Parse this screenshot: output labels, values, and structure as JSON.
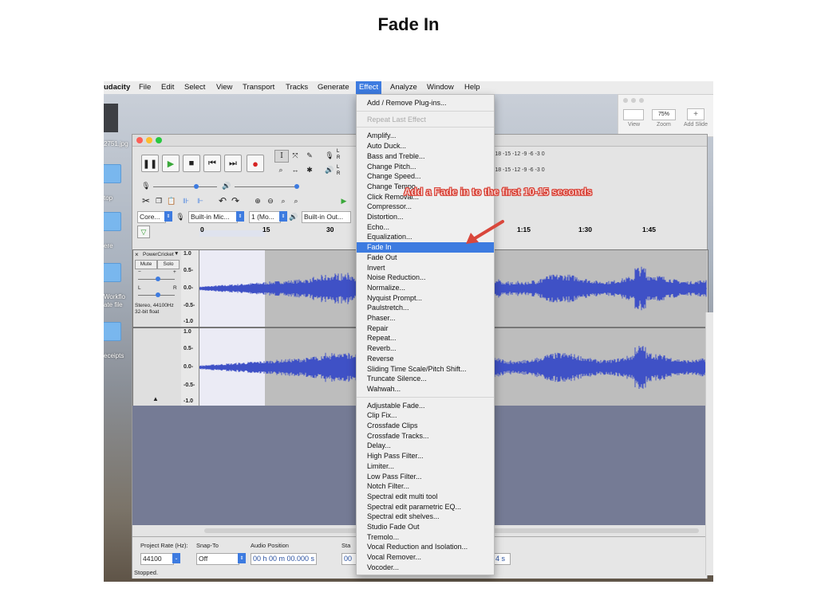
{
  "slide": {
    "title": "Fade In"
  },
  "menubar": {
    "app_name": "udacity",
    "items": [
      "File",
      "Edit",
      "Select",
      "View",
      "Transport",
      "Tracks",
      "Generate",
      "Effect",
      "Analyze",
      "Window",
      "Help"
    ]
  },
  "desktop": {
    "icons": [
      "2751.jpg",
      "top",
      "ere",
      "Workflo",
      "ate file",
      "eceipts"
    ]
  },
  "keynote": {
    "zoom": "75%",
    "view_label": "View",
    "zoom_label": "Zoom",
    "add_slide_label": "Add Slide",
    "plus": "+"
  },
  "toolbar": {
    "pause": "❚❚",
    "play": "▶",
    "stop": "■",
    "skip_start": "⏮",
    "skip_end": "⏭",
    "record": "●",
    "meter_scale": "-18 -15 -12 -9 -6 -3 0",
    "meter_scale_short": "-18 -15 -12 -9 -6 -3 0",
    "lr_top": "L",
    "lr_bottom": "R",
    "host_combo": "Core...",
    "input_device": "Built-in Mic...",
    "channels": "1 (Mo...",
    "output_device": "Built-in Out..."
  },
  "ruler": {
    "ticks": [
      "0",
      "15",
      "30",
      "1:15",
      "1:30",
      "1:45"
    ]
  },
  "tracks": {
    "name": "PowerCricket",
    "mute": "Mute",
    "solo": "Solo",
    "info": [
      "Stereo, 44100Hz",
      "32-bit float"
    ],
    "scale_top": [
      "1.0",
      "0.5-",
      "0.0-",
      "-0.5-",
      "-1.0"
    ],
    "scale_bottom": [
      "1.0",
      "0.5-",
      "0.0-",
      "-0.5-",
      "-1.0"
    ],
    "slider_minus": "−",
    "slider_plus": "+",
    "slider_l": "L",
    "slider_r": "R",
    "close": "×",
    "menu_arrow": "▼",
    "collapse": "▲"
  },
  "bottom": {
    "project_rate_label": "Project Rate (Hz):",
    "project_rate": "44100",
    "snap_to_label": "Snap-To",
    "snap_to": "Off",
    "audio_position_label": "Audio Position",
    "audio_position": "00 h 00 m 00.000 s",
    "audio_position_cut": "00",
    "sta_label": "Sta",
    "end_cut": "4 s",
    "status": "Stopped."
  },
  "effect_menu": {
    "items": [
      {
        "label": "Add / Remove Plug-ins..."
      },
      {
        "label": "Repeat Last Effect",
        "shortcut": "⌘R",
        "disabled": true
      },
      {
        "label": "Amplify..."
      },
      {
        "label": "Auto Duck..."
      },
      {
        "label": "Bass and Treble..."
      },
      {
        "label": "Change Pitch..."
      },
      {
        "label": "Change Speed..."
      },
      {
        "label": "Change Tempo..."
      },
      {
        "label": "Click Removal..."
      },
      {
        "label": "Compressor..."
      },
      {
        "label": "Distortion..."
      },
      {
        "label": "Echo..."
      },
      {
        "label": "Equalization..."
      },
      {
        "label": "Fade In",
        "highlight": true
      },
      {
        "label": "Fade Out"
      },
      {
        "label": "Invert"
      },
      {
        "label": "Noise Reduction..."
      },
      {
        "label": "Normalize..."
      },
      {
        "label": "Nyquist Prompt..."
      },
      {
        "label": "Paulstretch..."
      },
      {
        "label": "Phaser..."
      },
      {
        "label": "Repair"
      },
      {
        "label": "Repeat..."
      },
      {
        "label": "Reverb..."
      },
      {
        "label": "Reverse"
      },
      {
        "label": "Sliding Time Scale/Pitch Shift..."
      },
      {
        "label": "Truncate Silence..."
      },
      {
        "label": "Wahwah..."
      },
      {
        "label": "Adjustable Fade..."
      },
      {
        "label": "Clip Fix..."
      },
      {
        "label": "Crossfade Clips"
      },
      {
        "label": "Crossfade Tracks..."
      },
      {
        "label": "Delay..."
      },
      {
        "label": "High Pass Filter..."
      },
      {
        "label": "Limiter..."
      },
      {
        "label": "Low Pass Filter..."
      },
      {
        "label": "Notch Filter..."
      },
      {
        "label": "Spectral edit multi tool"
      },
      {
        "label": "Spectral edit parametric EQ..."
      },
      {
        "label": "Spectral edit shelves..."
      },
      {
        "label": "Studio Fade Out"
      },
      {
        "label": "Tremolo..."
      },
      {
        "label": "Vocal Reduction and Isolation..."
      },
      {
        "label": "Vocal Remover..."
      },
      {
        "label": "Vocoder..."
      }
    ]
  },
  "annotation": {
    "text": "Add a Fade in to the first 10-15 seconds",
    "color": "#d9473c"
  },
  "colors": {
    "accent": "#3d7be0",
    "waveform": "#3f51c6",
    "empty_track_area": "#757b95"
  }
}
